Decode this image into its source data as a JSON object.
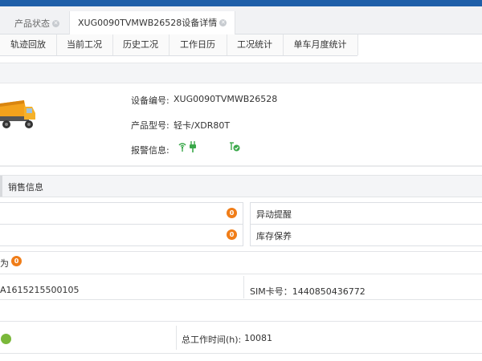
{
  "tabs": {
    "product_status": "产品状态",
    "device_detail": "XUG0090TVMWB26528设备详情"
  },
  "subnav": [
    "轨迹回放",
    "当前工况",
    "历史工况",
    "工作日历",
    "工况统计",
    "单车月度统计"
  ],
  "device": {
    "id_label": "设备编号:",
    "id_value": "XUG0090TVMWB26528",
    "model_label": "产品型号:",
    "model_value": "轻卡/XDR80T",
    "alarm_label": "报警信息:"
  },
  "sales_section": {
    "title": "销售信息"
  },
  "alerts": [
    {
      "count": "0",
      "label": "异动提醒"
    },
    {
      "count": "0",
      "label": "库存保养"
    }
  ],
  "line_for": {
    "text": "为",
    "count": "0"
  },
  "ids": {
    "left": "A1615215500105",
    "sim": "SIM卡号：1440850436772"
  },
  "work": {
    "total_label": "总工作时间(h):",
    "total_value": "10081"
  },
  "colors": {
    "accent": "#1f5fa8",
    "badge": "#f07d18",
    "online": "#7ab83a"
  },
  "icons": [
    "signal-icon",
    "plug-icon",
    "gps-check-icon",
    "truck-image"
  ]
}
